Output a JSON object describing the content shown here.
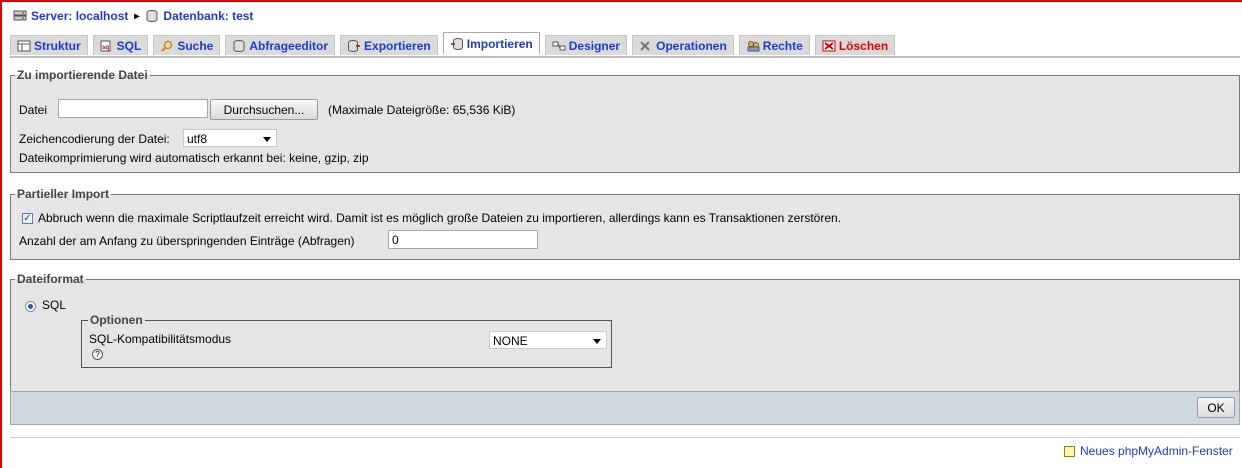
{
  "breadcrumb": {
    "server_label": "Server: localhost",
    "separator": "▸",
    "database_label": "Datenbank: test"
  },
  "tabs": [
    {
      "label": "Struktur",
      "icon": "structure-icon"
    },
    {
      "label": "SQL",
      "icon": "sql-icon"
    },
    {
      "label": "Suche",
      "icon": "search-icon"
    },
    {
      "label": "Abfrageeditor",
      "icon": "query-icon"
    },
    {
      "label": "Exportieren",
      "icon": "export-icon"
    },
    {
      "label": "Importieren",
      "icon": "import-icon",
      "active": true
    },
    {
      "label": "Designer",
      "icon": "designer-icon"
    },
    {
      "label": "Operationen",
      "icon": "operations-icon"
    },
    {
      "label": "Rechte",
      "icon": "privileges-icon"
    },
    {
      "label": "Löschen",
      "icon": "drop-icon",
      "danger": true
    }
  ],
  "import_file": {
    "legend": "Zu importierende Datei",
    "file_label": "Datei",
    "file_value": "",
    "browse_button": "Durchsuchen...",
    "max_size_note": "(Maximale Dateigröße: 65,536 KiB)",
    "charset_label": "Zeichencodierung der Datei:",
    "charset_value": "utf8",
    "compression_note": "Dateikomprimierung wird automatisch erkannt bei: keine, gzip, zip"
  },
  "partial_import": {
    "legend": "Partieller Import",
    "interrupt_checked": true,
    "interrupt_label": "Abbruch wenn die maximale Scriptlaufzeit erreicht wird. Damit ist es möglich große Dateien zu importieren, allerdings kann es Transaktionen zerstören.",
    "skip_label": "Anzahl der am Anfang zu überspringenden Einträge (Abfragen)",
    "skip_value": "0"
  },
  "format": {
    "legend": "Dateiformat",
    "selected_format": "SQL",
    "options_legend": "Optionen",
    "compat_label": "SQL-Kompatibilitätsmodus",
    "compat_value": "NONE",
    "help_glyph": "?"
  },
  "submit_label": "OK",
  "footer_link": "Neues phpMyAdmin-Fenster",
  "colors": {
    "link": "#1d3bd4",
    "danger": "#e00000",
    "panel": "#e5e5e5",
    "button_bar": "#d0d8e2"
  }
}
